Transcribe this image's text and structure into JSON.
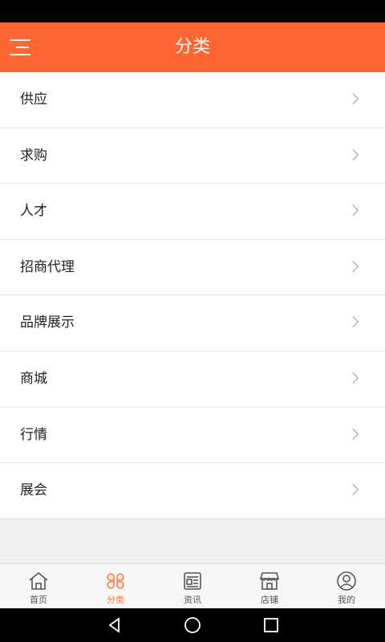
{
  "header": {
    "title": "分类",
    "menu_icon": "menu-icon"
  },
  "categories": [
    {
      "label": "供应"
    },
    {
      "label": "求购"
    },
    {
      "label": "人才"
    },
    {
      "label": "招商代理"
    },
    {
      "label": "品牌展示"
    },
    {
      "label": "商城"
    },
    {
      "label": "行情"
    },
    {
      "label": "展会"
    }
  ],
  "tabbar": {
    "items": [
      {
        "label": "首页",
        "icon": "home-icon"
      },
      {
        "label": "分类",
        "icon": "category-icon",
        "active": true
      },
      {
        "label": "资讯",
        "icon": "news-icon"
      },
      {
        "label": "店铺",
        "icon": "store-icon"
      },
      {
        "label": "我的",
        "icon": "profile-icon"
      }
    ]
  },
  "colors": {
    "accent": "#ff6633",
    "active_tab": "#ff7a3d"
  }
}
